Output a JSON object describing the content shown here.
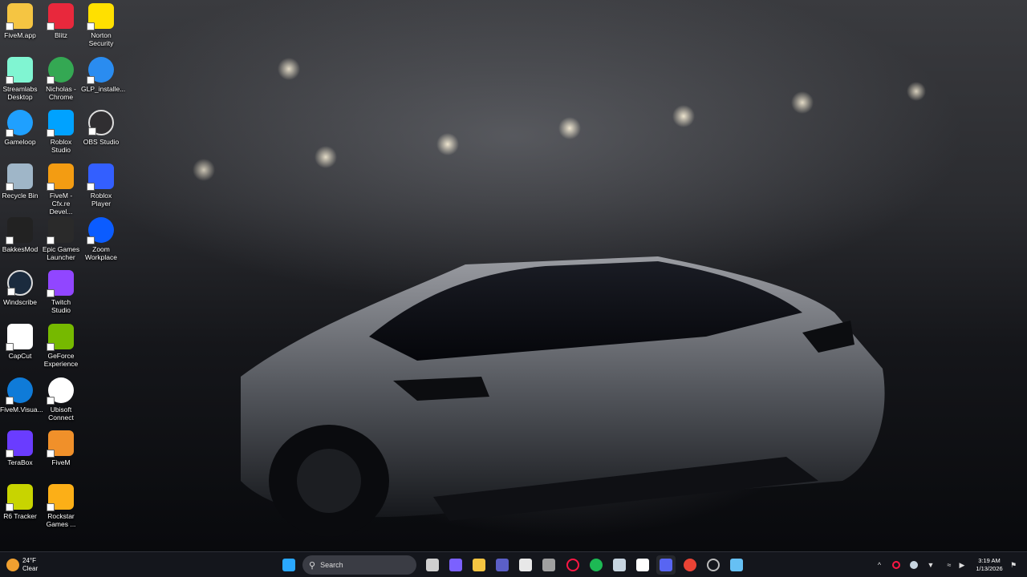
{
  "desktop": {
    "icons": [
      {
        "label": "FiveM.app",
        "icon": "folder-icon",
        "color": "#f5c542"
      },
      {
        "label": "Blitz",
        "icon": "blitz-icon",
        "color": "#e8283c"
      },
      {
        "label": "Norton Security",
        "icon": "norton-icon",
        "color": "#ffe000"
      },
      {
        "label": "Streamlabs Desktop",
        "icon": "streamlabs-icon",
        "color": "#80f5d2"
      },
      {
        "label": "Nicholas - Chrome",
        "icon": "chrome-icon",
        "color": "#34a853"
      },
      {
        "label": "GLP_installe...",
        "icon": "glp-installer-icon",
        "color": "#2a8cf0"
      },
      {
        "label": "Gameloop",
        "icon": "gameloop-icon",
        "color": "#1fa0ff"
      },
      {
        "label": "Roblox Studio",
        "icon": "roblox-studio-icon",
        "color": "#00a2ff"
      },
      {
        "label": "OBS Studio",
        "icon": "obs-icon",
        "color": "#302e31"
      },
      {
        "label": "Recycle Bin",
        "icon": "recycle-bin-icon",
        "color": "#9fb6c8"
      },
      {
        "label": "FiveM - Cfx.re Devel...",
        "icon": "fivem-dev-icon",
        "color": "#f39c12"
      },
      {
        "label": "Roblox Player",
        "icon": "roblox-player-icon",
        "color": "#335fff"
      },
      {
        "label": "BakkesMod",
        "icon": "bakkesmod-icon",
        "color": "#222222"
      },
      {
        "label": "Epic Games Launcher",
        "icon": "epic-games-icon",
        "color": "#2a2a2a"
      },
      {
        "label": "Zoom Workplace",
        "icon": "zoom-icon",
        "color": "#0b5cff"
      },
      {
        "label": "Windscribe",
        "icon": "windscribe-icon",
        "color": "#1b2b3e"
      },
      {
        "label": "Twitch Studio",
        "icon": "twitch-icon",
        "color": "#9146ff"
      },
      {
        "label": "CapCut",
        "icon": "capcut-icon",
        "color": "#ffffff"
      },
      {
        "label": "GeForce Experience",
        "icon": "geforce-icon",
        "color": "#76b900"
      },
      {
        "label": "FiveM.Visua...",
        "icon": "edge-icon",
        "color": "#0f7bd8"
      },
      {
        "label": "Ubisoft Connect",
        "icon": "ubisoft-icon",
        "color": "#ffffff"
      },
      {
        "label": "TeraBox",
        "icon": "terabox-icon",
        "color": "#6a3cff"
      },
      {
        "label": "FiveM",
        "icon": "fivem-icon",
        "color": "#f0902a"
      },
      {
        "label": "R6 Tracker",
        "icon": "r6-tracker-icon",
        "color": "#c8d400"
      },
      {
        "label": "Rockstar Games ...",
        "icon": "rockstar-icon",
        "color": "#fcaf17"
      }
    ]
  },
  "taskbar": {
    "weather": {
      "temp": "24°F",
      "condition": "Clear"
    },
    "search_placeholder": "Search",
    "apps": [
      {
        "name": "start-icon",
        "color": "#2aa8ff"
      },
      {
        "name": "task-view-icon",
        "color": "#cfcfcf"
      },
      {
        "name": "copilot-icon",
        "color": "#7b61ff"
      },
      {
        "name": "file-explorer-icon",
        "color": "#f5c542"
      },
      {
        "name": "teams-icon",
        "color": "#5b5fc7"
      },
      {
        "name": "store-icon",
        "color": "#e8e8e8"
      },
      {
        "name": "calculator-icon",
        "color": "#a0a0a0"
      },
      {
        "name": "opera-gx-icon",
        "color": "#ff1744"
      },
      {
        "name": "spotify-icon",
        "color": "#1db954"
      },
      {
        "name": "steam-icon",
        "color": "#c7d5e0"
      },
      {
        "name": "notepad-icon",
        "color": "#ffffff"
      },
      {
        "name": "discord-icon",
        "color": "#5865f2"
      },
      {
        "name": "chrome-icon",
        "color": "#ea4335"
      },
      {
        "name": "obs-icon",
        "color": "#bbbbbb"
      },
      {
        "name": "steam-icon",
        "color": "#66c0f4"
      }
    ],
    "clock": {
      "time": "3:19 AM",
      "date": "1/13/2026"
    }
  }
}
